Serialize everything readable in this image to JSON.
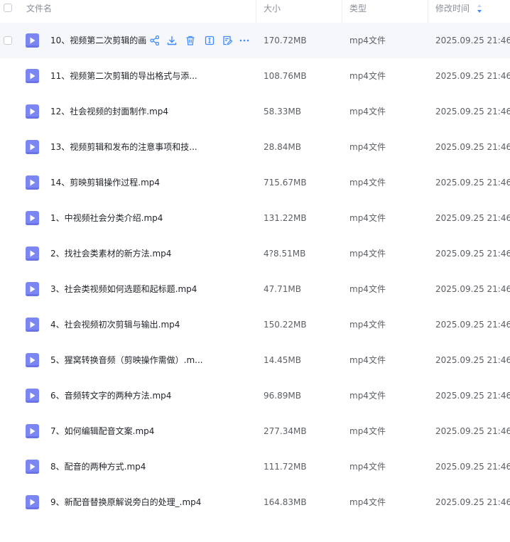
{
  "header": {
    "name_label": "文件名",
    "size_label": "大小",
    "type_label": "类型",
    "mtime_label": "修改时间"
  },
  "accent_color": "#7b86f2",
  "files": [
    {
      "name": "10、视频第二次剪辑的画",
      "size": "170.72MB",
      "type": "mp4文件",
      "mtime": "2025.09.25 21:46"
    },
    {
      "name": "11、视频第二次剪辑的导出格式与添...",
      "size": "108.76MB",
      "type": "mp4文件",
      "mtime": "2025.09.25 21:46"
    },
    {
      "name": "12、社会视频的封面制作.mp4",
      "size": "58.33MB",
      "type": "mp4文件",
      "mtime": "2025.09.25 21:46"
    },
    {
      "name": "13、视频剪辑和发布的注意事项和技...",
      "size": "28.84MB",
      "type": "mp4文件",
      "mtime": "2025.09.25 21:46"
    },
    {
      "name": "14、剪映剪辑操作过程.mp4",
      "size": "715.67MB",
      "type": "mp4文件",
      "mtime": "2025.09.25 21:46"
    },
    {
      "name": "1、中视频社会分类介绍.mp4",
      "size": "131.22MB",
      "type": "mp4文件",
      "mtime": "2025.09.25 21:46"
    },
    {
      "name": "2、找社会类素材的新方法.mp4",
      "size": "4?8.51MB",
      "type": "mp4文件",
      "mtime": "2025.09.25 21:46"
    },
    {
      "name": "3、社会类视频如何选题和起标题.mp4",
      "size": "47.71MB",
      "type": "mp4文件",
      "mtime": "2025.09.25 21:46"
    },
    {
      "name": "4、社会视频初次剪辑与输出.mp4",
      "size": "150.22MB",
      "type": "mp4文件",
      "mtime": "2025.09.25 21:46"
    },
    {
      "name": "5、猩窝转换音频（剪映操作需做）.m...",
      "size": "14.45MB",
      "type": "mp4文件",
      "mtime": "2025.09.25 21:46"
    },
    {
      "name": "6、音频转文字的两种方法.mp4",
      "size": "96.89MB",
      "type": "mp4文件",
      "mtime": "2025.09.25 21:46"
    },
    {
      "name": "7、如何编辑配音文案.mp4",
      "size": "277.34MB",
      "type": "mp4文件",
      "mtime": "2025.09.25 21:46"
    },
    {
      "name": "8、配音的两种方式.mp4",
      "size": "111.72MB",
      "type": "mp4文件",
      "mtime": "2025.09.25 21:46"
    },
    {
      "name": "9、新配音替换原解说旁白的处理_.mp4",
      "size": "164.83MB",
      "type": "mp4文件",
      "mtime": "2025.09.25 21:46"
    }
  ],
  "row_actions": [
    "share-icon",
    "download-icon",
    "delete-icon",
    "rename-icon",
    "edit-icon",
    "more-icon"
  ]
}
